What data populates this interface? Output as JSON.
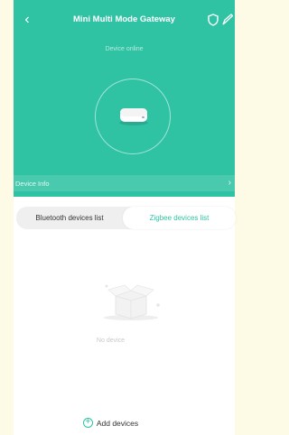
{
  "header": {
    "title": "Mini Multi Mode Gateway",
    "back_icon": "back-arrow-icon",
    "shield_icon": "shield-icon",
    "edit_icon": "edit-icon"
  },
  "device": {
    "status": "Device online",
    "image_icon": "gateway-device-icon"
  },
  "info_bar": {
    "label": "Device Info",
    "chevron": "›"
  },
  "tabs": [
    {
      "label": "Bluetooth devices list",
      "active": false
    },
    {
      "label": "Zigbee devices list",
      "active": true
    }
  ],
  "empty_state": {
    "icon": "empty-box-icon",
    "text": "No device"
  },
  "footer": {
    "add_label": "Add devices",
    "add_icon": "plus-circle-icon"
  },
  "colors": {
    "accent": "#2fc3a4",
    "background": "#fdfbe6"
  }
}
